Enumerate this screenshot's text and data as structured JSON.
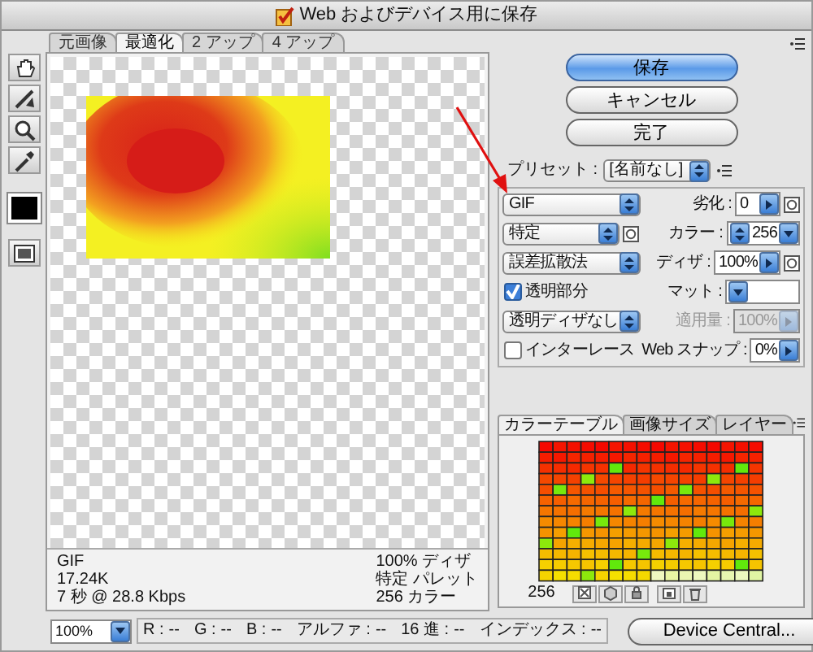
{
  "window": {
    "title": "Web およびデバイス用に保存"
  },
  "view_tabs": [
    {
      "label": "元画像",
      "selected": false
    },
    {
      "label": "最適化",
      "selected": true
    },
    {
      "label": "2 アップ",
      "selected": false
    },
    {
      "label": "4 アップ",
      "selected": false
    }
  ],
  "info": {
    "left": [
      "GIF",
      "17.24K",
      "7 秒 @ 28.8 Kbps"
    ],
    "right": [
      "100% ディザ",
      "特定 パレット",
      "256 カラー"
    ]
  },
  "zoom": {
    "value": "100%"
  },
  "readout": [
    {
      "label": "R :",
      "value": "--"
    },
    {
      "label": "G :",
      "value": "--"
    },
    {
      "label": "B :",
      "value": "--"
    },
    {
      "label": "アルファ :",
      "value": "--"
    },
    {
      "label": "16 進 :",
      "value": "--"
    },
    {
      "label": "インデックス :",
      "value": "--"
    }
  ],
  "buttons": [
    {
      "label": "保存",
      "default": true
    },
    {
      "label": "キャンセル",
      "default": false
    },
    {
      "label": "完了",
      "default": false
    }
  ],
  "preset": {
    "label": "プリセット :",
    "value": "[名前なし]"
  },
  "settings": [
    {
      "left": {
        "kind": "select",
        "value": "GIF",
        "mask_button": false
      },
      "right": {
        "kind": "popup",
        "label": "劣化 :",
        "value": "0",
        "disabled": false,
        "mask_button": true
      }
    },
    {
      "left": {
        "kind": "select",
        "value": "特定",
        "mask_button": true
      },
      "right": {
        "kind": "stepper",
        "label": "カラー :",
        "value": "256",
        "disabled": false,
        "mask_button": false
      }
    },
    {
      "left": {
        "kind": "select",
        "value": "誤差拡散法",
        "mask_button": false
      },
      "right": {
        "kind": "popup",
        "label": "ディザ :",
        "value": "100%",
        "disabled": false,
        "mask_button": true
      }
    },
    {
      "left": {
        "kind": "checkbox",
        "value": "透明部分",
        "checked": true
      },
      "right": {
        "kind": "combo",
        "label": "マット :",
        "disabled": false,
        "mask_button": false
      }
    },
    {
      "left": {
        "kind": "select",
        "value": "透明ディザなし",
        "mask_button": false
      },
      "right": {
        "kind": "popup",
        "label": "適用量 :",
        "value": "100%",
        "disabled": true,
        "mask_button": false
      }
    },
    {
      "left": {
        "kind": "checkbox",
        "value": "インターレース",
        "checked": false
      },
      "right": {
        "kind": "popup",
        "label": "Web スナップ :",
        "value": "0%",
        "disabled": false,
        "mask_button": false
      }
    }
  ],
  "panel_tabs": [
    {
      "label": "カラーテーブル",
      "selected": true
    },
    {
      "label": "画像サイズ",
      "selected": false
    },
    {
      "label": "レイヤー",
      "selected": false
    }
  ],
  "color_count": "256",
  "device_button": "Device Central..."
}
